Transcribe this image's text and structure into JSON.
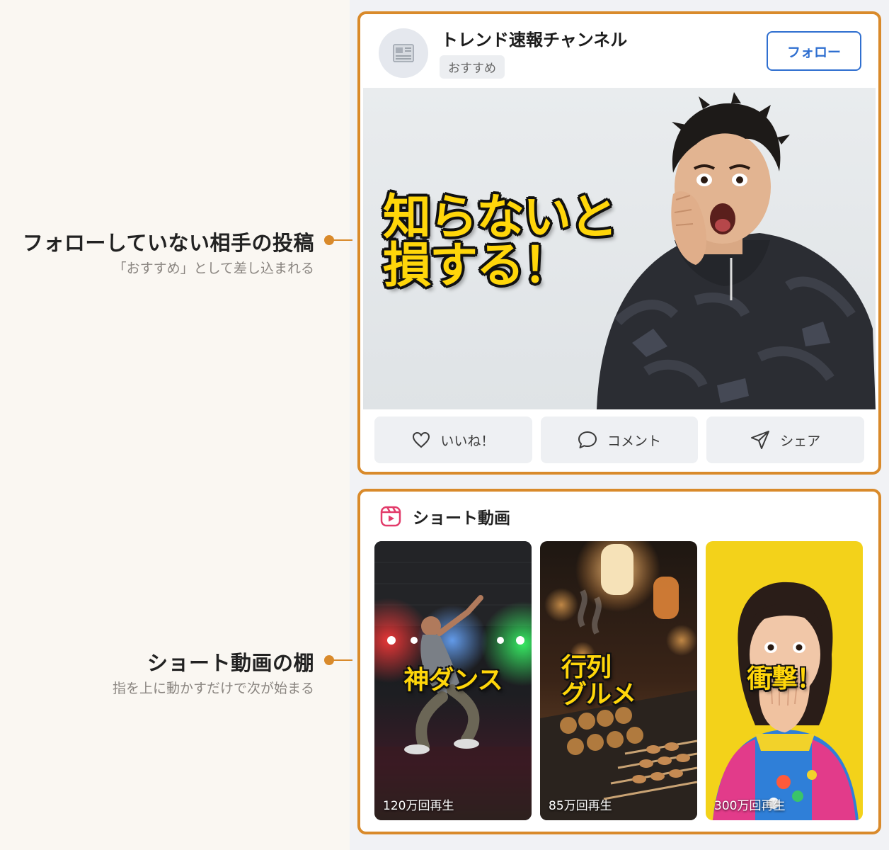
{
  "annotations": [
    {
      "title": "フォローしていない相手の投稿",
      "subtitle": "「おすすめ」として差し込まれる"
    },
    {
      "title": "ショート動画の棚",
      "subtitle": "指を上に動かすだけで次が始まる"
    }
  ],
  "post": {
    "channel_name": "トレンド速報チャンネル",
    "badge": "おすすめ",
    "follow_label": "フォロー",
    "headline_line1": "知らないと",
    "headline_line2": "損する！",
    "actions": {
      "like": "いいね！",
      "comment": "コメント",
      "share": "シェア"
    }
  },
  "shorts": {
    "title": "ショート動画",
    "items": [
      {
        "caption": "神ダンス",
        "views": "120万回再生"
      },
      {
        "caption_line1": "行列",
        "caption_line2": "グルメ",
        "views": "85万回再生"
      },
      {
        "caption": "衝撃！",
        "views": "300万回再生"
      }
    ]
  },
  "colors": {
    "accent": "#d98a2b",
    "follow": "#2f6fd0",
    "caption": "#ffd60a",
    "shorts_icon": "#e23b6a"
  },
  "icons": [
    "newspaper-icon",
    "heart-icon",
    "comment-icon",
    "share-icon",
    "shorts-icon"
  ]
}
